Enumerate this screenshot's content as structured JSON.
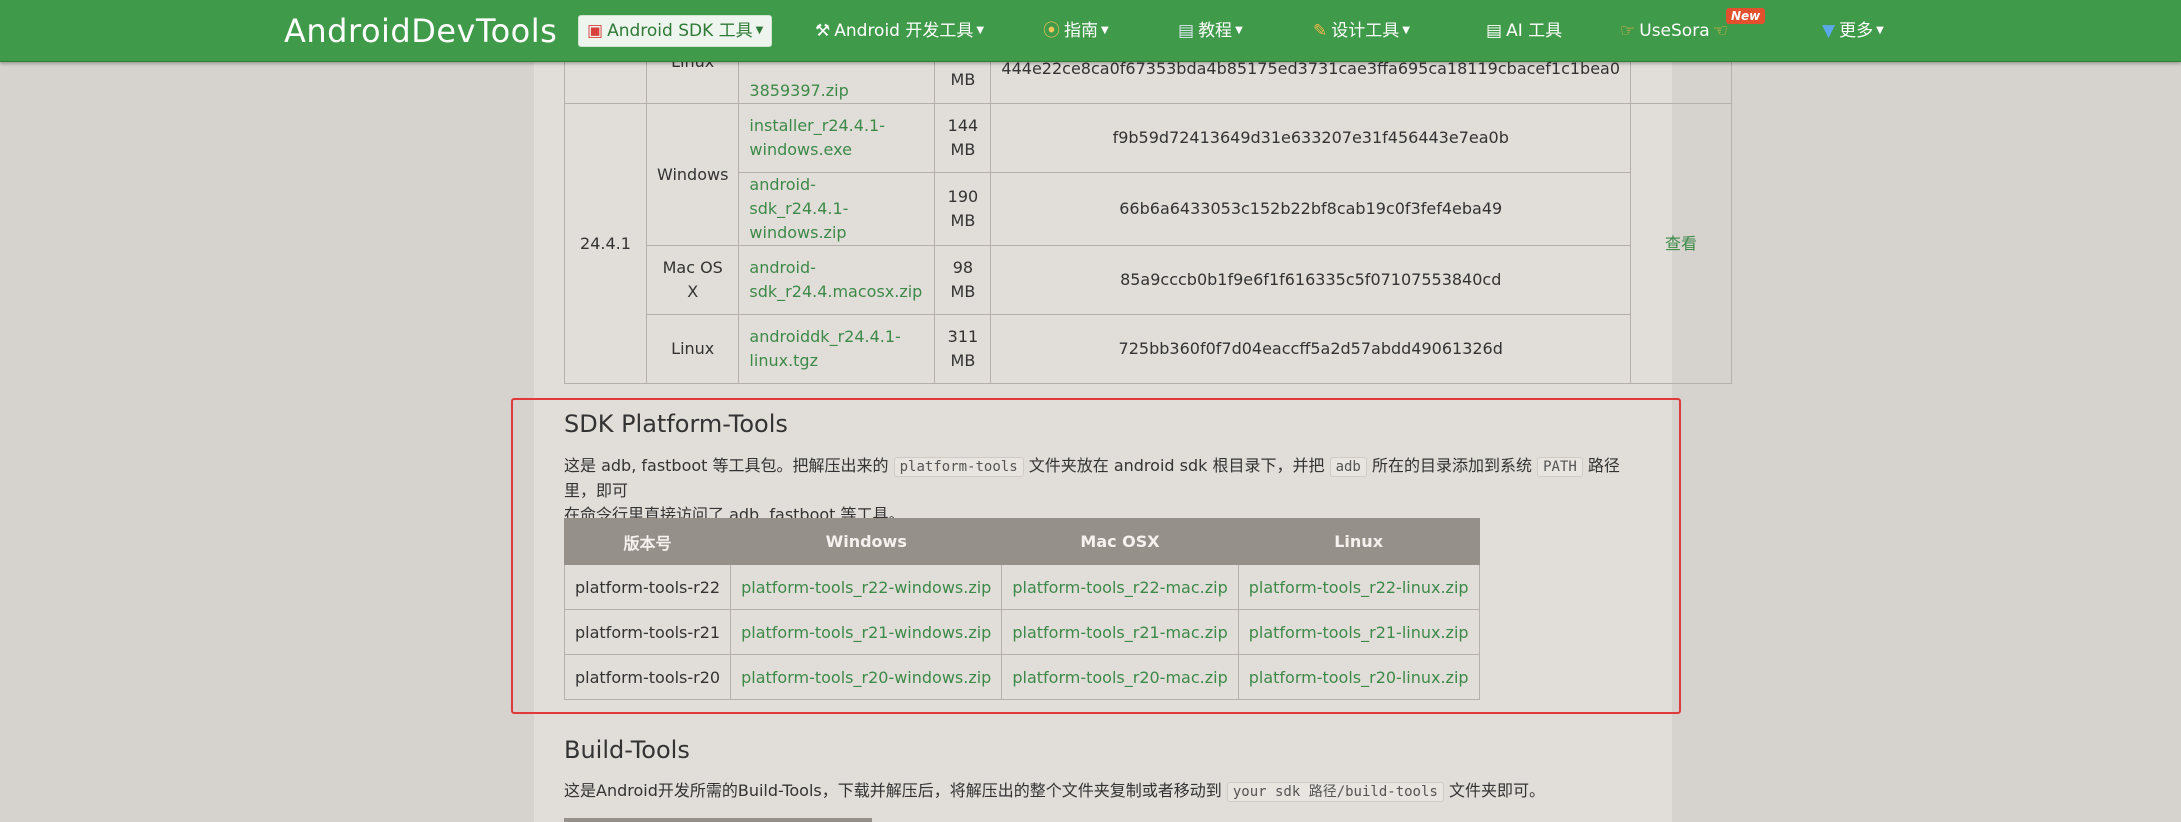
{
  "nav": {
    "brand": "AndroidDevTools",
    "sdk_tools": "Android SDK 工具",
    "dev_tools": "Android 开发工具",
    "guide": "指南",
    "tutorial": "教程",
    "design": "设计工具",
    "ai": "AI 工具",
    "usesora": "UseSora",
    "new_badge": "New",
    "more": "更多"
  },
  "sdk_table": {
    "top_row": {
      "os": "Linux",
      "file": "3859397.zip",
      "size": "MB",
      "sha": "444e22ce8ca0f67353bda4b85175ed3731cae3ffa695ca18119cbacef1c1bea0"
    },
    "version": "24.4.1",
    "view": "查看",
    "rows": [
      {
        "os": "Windows",
        "file": "installer_r24.4.1-windows.exe",
        "size": "144 MB",
        "sha": "f9b59d72413649d31e633207e31f456443e7ea0b"
      },
      {
        "os": "",
        "file": "android-sdk_r24.4.1-windows.zip",
        "size": "190 MB",
        "sha": "66b6a6433053c152b22bf8cab19c0f3fef4eba49"
      },
      {
        "os": "Mac OS X",
        "file": "android-sdk_r24.4.macosx.zip",
        "size": "98 MB",
        "sha": "85a9cccb0b1f9e6f1f616335c5f07107553840cd"
      },
      {
        "os": "Linux",
        "file": "androiddk_r24.4.1-linux.tgz",
        "size": "311 MB",
        "sha": "725bb360f0f7d04eaccff5a2d57abdd49061326d"
      }
    ]
  },
  "platform_tools": {
    "title": "SDK Platform-Tools",
    "desc_1": "这是 adb, fastboot 等工具包。把解压出来的",
    "code_1": "platform-tools",
    "desc_2": "文件夹放在 android sdk 根目录下，并把",
    "code_2": "adb",
    "desc_3": "所在的目录添加到系统",
    "code_3": "PATH",
    "desc_4": "路径里，即可",
    "desc_5": "在命令行里直接访问了 adb, fastboot 等工具。",
    "headers": [
      "版本号",
      "Windows",
      "Mac OSX",
      "Linux"
    ],
    "rows": [
      {
        "version": "platform-tools-r22",
        "win": "platform-tools_r22-windows.zip",
        "mac": "platform-tools_r22-mac.zip",
        "linux": "platform-tools_r22-linux.zip"
      },
      {
        "version": "platform-tools-r21",
        "win": "platform-tools_r21-windows.zip",
        "mac": "platform-tools_r21-mac.zip",
        "linux": "platform-tools_r21-linux.zip"
      },
      {
        "version": "platform-tools-r20",
        "win": "platform-tools_r20-windows.zip",
        "mac": "platform-tools_r20-mac.zip",
        "linux": "platform-tools_r20-linux.zip"
      }
    ]
  },
  "build_tools": {
    "title": "Build-Tools",
    "desc_1": "这是Android开发所需的Build-Tools，下载并解压后，将解压出的整个文件夹复制或者移动到",
    "code_1": "your sdk 路径/build-tools",
    "desc_2": "文件夹即可。"
  },
  "colors": {
    "nav": "#3f9a49",
    "link": "#3d8a48",
    "highlight": "#e0393b",
    "table_header": "#959089"
  }
}
